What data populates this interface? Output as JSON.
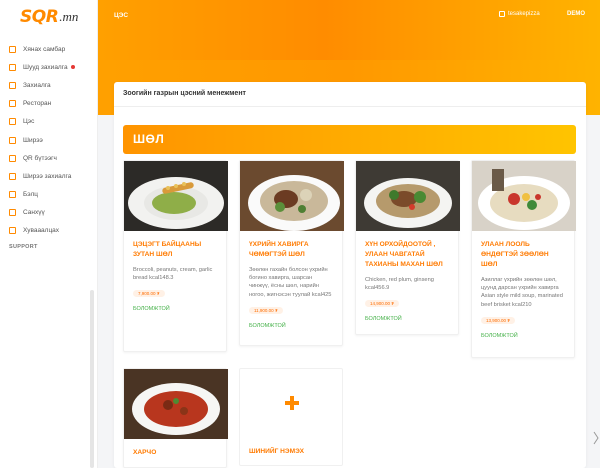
{
  "logo": {
    "brand": "SQR",
    "tld": ".mn"
  },
  "sidebar": {
    "items": [
      {
        "label": "Хянах самбар",
        "icon": "monitor-icon"
      },
      {
        "label": "Шууд захиалга",
        "icon": "calendar-icon",
        "live": true
      },
      {
        "label": "Захиалга",
        "icon": "clipboard-icon"
      },
      {
        "label": "Ресторан",
        "icon": "store-icon"
      },
      {
        "label": "Цэс",
        "icon": "menu-book-icon"
      },
      {
        "label": "Ширээ",
        "icon": "table-icon"
      },
      {
        "label": "QR бүтээгч",
        "icon": "qr-icon"
      },
      {
        "label": "Ширээ захиалга",
        "icon": "reservation-icon"
      },
      {
        "label": "Бэлц",
        "icon": "receipt-icon"
      },
      {
        "label": "Санхүү",
        "icon": "wallet-icon"
      },
      {
        "label": "Хувааалцах",
        "icon": "share-icon"
      }
    ],
    "support_label": "SUPPORT"
  },
  "header": {
    "breadcrumb": "ЦЭС",
    "user": "tesakepizza",
    "demo": "DEMO"
  },
  "card": {
    "title": "Зоогийн газрын цэсний менежмент"
  },
  "section": {
    "title": "ШӨЛ"
  },
  "items": [
    {
      "name": "ЦЭЦЭГТ БАЙЦААНЫ ЗУТАН ШӨЛ",
      "desc": "Broccoli, peanuts, cream, garlic bread kcal148.3",
      "price": "7,900.00 ₮",
      "status": "БОЛОМЖТОЙ"
    },
    {
      "name": "ҮХРИЙН ХАВИРГА ЧӨМӨГТЭЙ ШӨЛ",
      "desc": "Зөөлөн гахайн болсон үхрийн богино хавирга, шарсан чинжүү, ёсны шөл, нарийн ногоо, жигнэсэн туулай kcal425",
      "price": "11,900.00 ₮",
      "status": "БОЛОМЖТОЙ"
    },
    {
      "name": "ХҮН ОРХОЙДООТОЙ , УЛААН ЧАВГАТАЙ ТАХИАНЫ МАХАН ШӨЛ",
      "desc": "Chicken, red plum, ginseng kcal456.9",
      "price": "14,900.00 ₮",
      "status": "БОЛОМЖТОЙ"
    },
    {
      "name": "УЛААН ЛООЛЬ ӨНДӨГТЭЙ ЗӨӨЛӨН ШӨЛ",
      "desc": "Азиллаг үхрийн зөөлөн шөл, цуунд дарсан үхрийн хавирга Asian style mild soup, marinated beef brisket kcal210",
      "price": "13,900.00 ₮",
      "status": "БОЛОМЖТОЙ"
    },
    {
      "name": "ХАРЧО"
    }
  ],
  "add_item_label": "ШИНИЙГ НЭМЭХ",
  "colors": {
    "accent": "#ff8a00",
    "available": "#43b047",
    "price_bg": "#fff1e6"
  }
}
